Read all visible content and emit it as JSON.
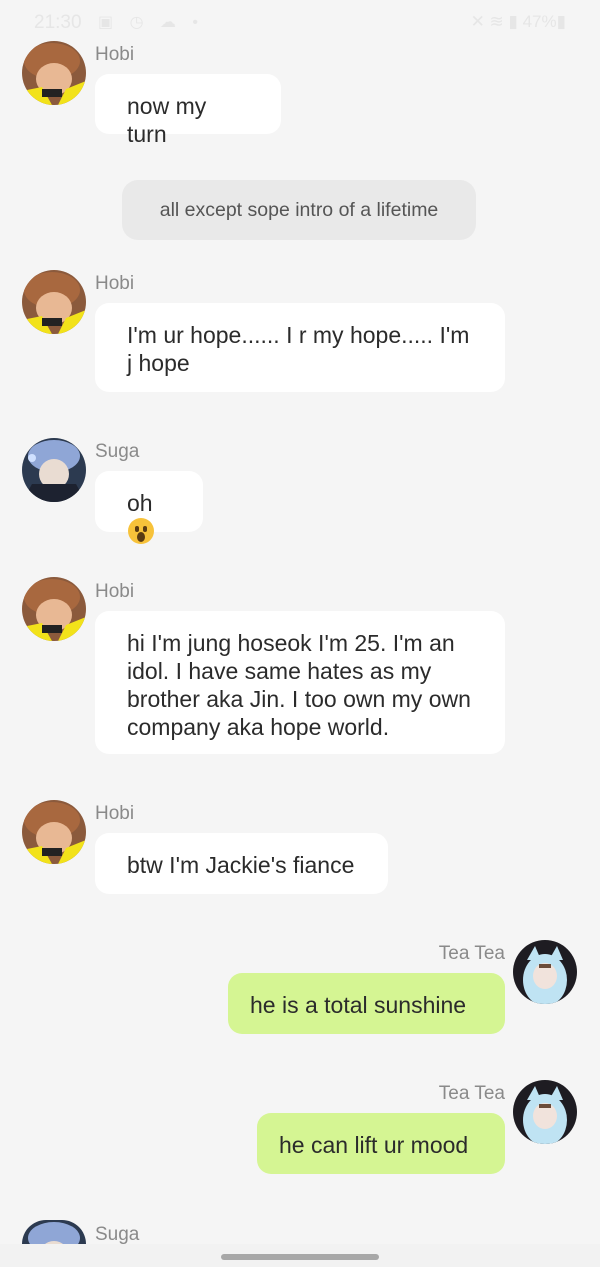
{
  "status_bar": {
    "time": "21:30",
    "left_icons": "▣ ◷ ☁ •",
    "right_icons": "✕ ≋ ▮ 47%▮",
    "battery": "47%"
  },
  "messages": [
    {
      "sender": "Hobi",
      "text": "now my turn",
      "avatar": "hobi-avatar"
    },
    {
      "system": "all except sope intro of a lifetime"
    },
    {
      "sender": "Hobi",
      "text": "I'm ur hope...... I r my hope..... I'm j hope",
      "avatar": "hobi-avatar"
    },
    {
      "sender": "Suga",
      "text": "oh",
      "emoji": "surprised-emoji",
      "avatar": "suga-avatar"
    },
    {
      "sender": "Hobi",
      "text": "hi I'm jung hoseok I'm 25. I'm an idol. I have same hates as my brother aka Jin. I too own my own company aka hope world.",
      "avatar": "hobi-avatar"
    },
    {
      "sender": "Hobi",
      "text": "btw I'm Jackie's fiance",
      "avatar": "hobi-avatar"
    },
    {
      "sender": "Tea Tea",
      "text": "he is a total sunshine",
      "avatar": "teatea-avatar",
      "outgoing": true
    },
    {
      "sender": "Tea Tea",
      "text": "he can lift ur mood",
      "avatar": "teatea-avatar",
      "outgoing": true
    },
    {
      "sender": "Suga",
      "text": "",
      "avatar": "suga-avatar"
    }
  ],
  "colors": {
    "background": "#f5f5f5",
    "incoming_bubble": "#ffffff",
    "outgoing_bubble": "#d5f593",
    "system_bubble": "#e9e9e9",
    "sender_name": "#8a8a8a"
  }
}
